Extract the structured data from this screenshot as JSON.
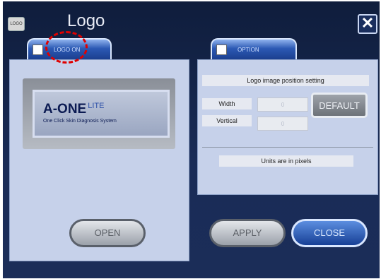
{
  "window": {
    "title": "Logo",
    "app_icon_text": "LOGO",
    "close_glyph": "✕"
  },
  "tabs": {
    "logo_on": {
      "label": "LOGO ON",
      "checked": false
    },
    "option": {
      "label": "OPTION",
      "checked": false
    }
  },
  "logo_preview": {
    "main": "A-ONE",
    "sup": "LITE",
    "sub": "One Click Skin Diagnosis System"
  },
  "position": {
    "header": "Logo image position setting",
    "width_label": "Width",
    "width_value": "0",
    "vertical_label": "Vertical",
    "vertical_value": "0",
    "default_label": "DEFAULT",
    "units_note": "Units are in pixels"
  },
  "buttons": {
    "open": "OPEN",
    "apply": "APPLY",
    "close": "CLOSE"
  },
  "colors": {
    "window_bg": "#1a2c57",
    "panel_bg": "#c6d1ea",
    "accent_blue": "#2c59b4",
    "annotation_red": "#e00000"
  }
}
